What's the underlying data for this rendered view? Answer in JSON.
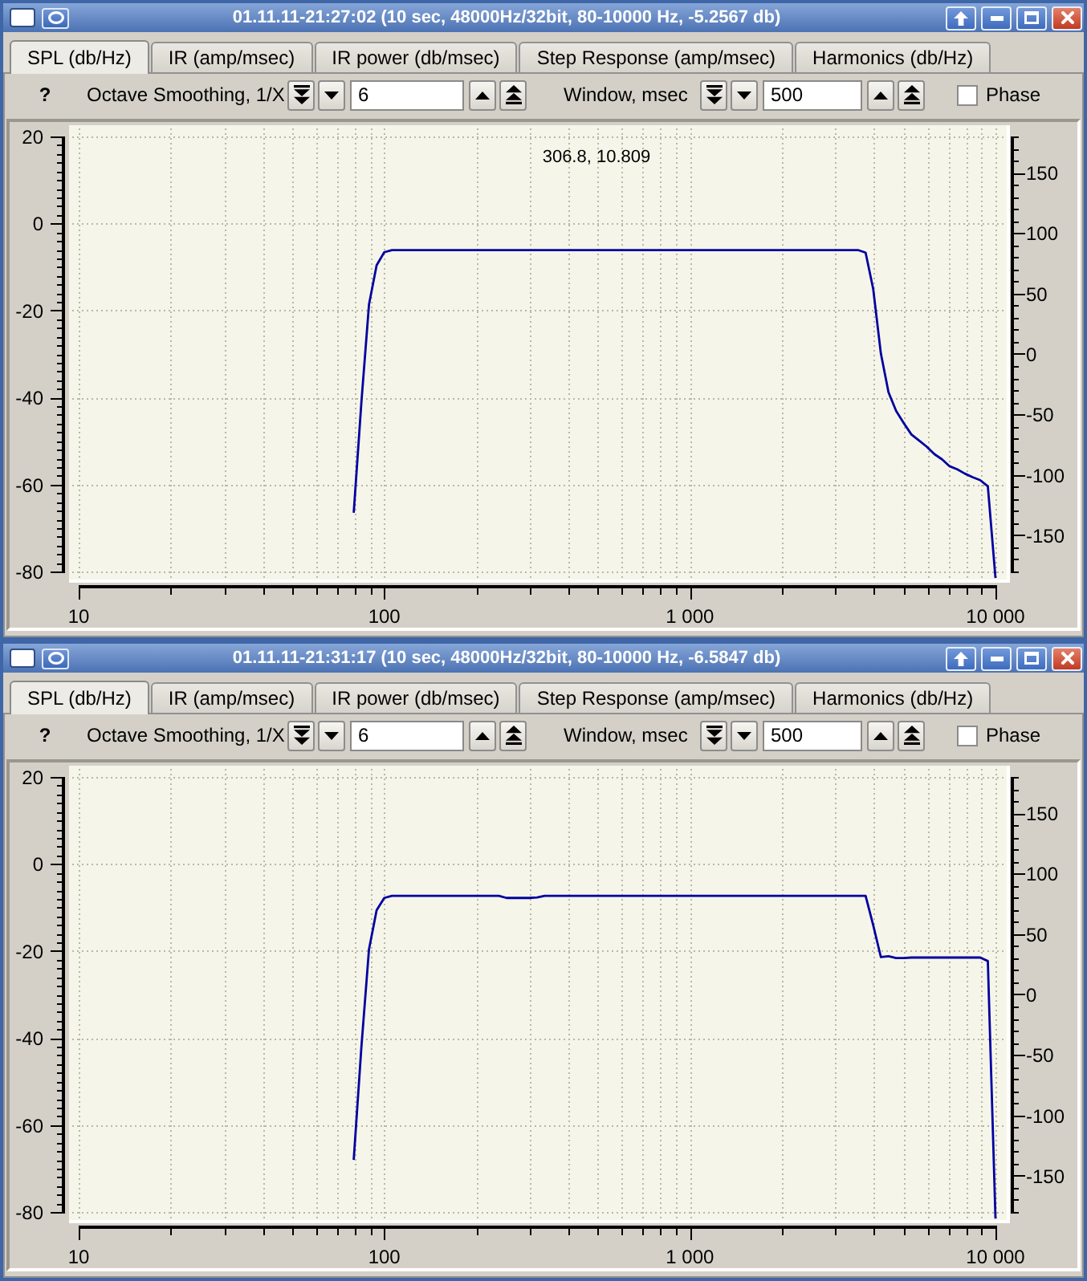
{
  "windows": [
    {
      "title": "01.11.11-21:27:02 (10 sec, 48000Hz/32bit, 80-10000 Hz, -5.2567 db)",
      "tabs": [
        {
          "label": "SPL (db/Hz)",
          "selected": true
        },
        {
          "label": "IR (amp/msec)",
          "selected": false
        },
        {
          "label": "IR power (db/msec)",
          "selected": false
        },
        {
          "label": "Step Response (amp/msec)",
          "selected": false
        },
        {
          "label": "Harmonics (db/Hz)",
          "selected": false
        }
      ],
      "toolbar": {
        "help": "?",
        "smoothing": {
          "label": "Octave Smoothing, 1/X",
          "value": "6"
        },
        "window": {
          "label": "Window, msec",
          "value": "500"
        },
        "phase": {
          "label": "Phase",
          "checked": false
        }
      },
      "chart_data": {
        "type": "line",
        "grid": true,
        "ylim": [
          -82.2,
          22.6
        ],
        "yticks": [
          20,
          0,
          -20,
          -40,
          -60,
          -80
        ],
        "y2lim": [
          -188,
          189.3
        ],
        "y2ticks": [
          150,
          100,
          50,
          0,
          -50,
          -100,
          -150
        ],
        "categories": [
          "10",
          null,
          null,
          null,
          null,
          null,
          null,
          null,
          null,
          null,
          null,
          null,
          null,
          null,
          null,
          null,
          null,
          null,
          null,
          null,
          null,
          null,
          null,
          null,
          null,
          null,
          null,
          null,
          null,
          null,
          null,
          null,
          null,
          null,
          null,
          null,
          null,
          null,
          null,
          null,
          "100",
          null,
          null,
          null,
          null,
          null,
          null,
          null,
          null,
          null,
          null,
          null,
          null,
          null,
          null,
          null,
          null,
          null,
          null,
          null,
          null,
          null,
          null,
          null,
          null,
          null,
          null,
          null,
          null,
          null,
          null,
          null,
          null,
          null,
          null,
          null,
          null,
          null,
          null,
          null,
          "1 000",
          null,
          null,
          null,
          null,
          null,
          null,
          null,
          null,
          null,
          null,
          null,
          null,
          null,
          null,
          null,
          null,
          null,
          null,
          null,
          null,
          null,
          null,
          null,
          null,
          null,
          null,
          null,
          null,
          null,
          null,
          null,
          null,
          null,
          null,
          null,
          null,
          null,
          null,
          null,
          "10 000"
        ],
        "series": [
          {
            "color": "#0000a0",
            "values": [
              null,
              null,
              null,
              null,
              null,
              null,
              null,
              null,
              null,
              null,
              null,
              null,
              null,
              null,
              null,
              null,
              null,
              null,
              null,
              null,
              null,
              null,
              null,
              null,
              null,
              null,
              null,
              null,
              null,
              null,
              null,
              null,
              null,
              null,
              null,
              null,
              -66.5,
              -41.2,
              -18.6,
              -9.6,
              -6.6,
              -6.1,
              -6.1,
              -6.1,
              -6.1,
              -6.1,
              -6.1,
              -6.1,
              -6.1,
              -6.1,
              -6.1,
              -6.1,
              -6.1,
              -6.1,
              -6.1,
              -6.1,
              -6.1,
              -6.1,
              -6.1,
              -6.1,
              -6.1,
              -6.1,
              -6.1,
              -6.1,
              -6.1,
              -6.1,
              -6.1,
              -6.1,
              -6.1,
              -6.1,
              -6.1,
              -6.1,
              -6.1,
              -6.1,
              -6.1,
              -6.1,
              -6.1,
              -6.1,
              -6.1,
              -6.1,
              -6.1,
              -6.1,
              -6.1,
              -6.1,
              -6.1,
              -6.1,
              -6.1,
              -6.1,
              -6.1,
              -6.1,
              -6.1,
              -6.1,
              -6.1,
              -6.1,
              -6.1,
              -6.1,
              -6.1,
              -6.1,
              -6.1,
              -6.1,
              -6.1,
              -6.1,
              -6.1,
              -6.7,
              -15.1,
              -29.9,
              -38.8,
              -43.1,
              -45.9,
              -48.5,
              -49.9,
              -51.3,
              -53,
              -54.2,
              -55.8,
              -56.5,
              -57.5,
              -58.3,
              -59,
              -60.4,
              -81.5
            ]
          }
        ],
        "annotations": [
          "306.8, 10.809"
        ]
      }
    },
    {
      "title": "01.11.11-21:31:17 (10 sec, 48000Hz/32bit, 80-10000 Hz, -6.5847 db)",
      "tabs": [
        {
          "label": "SPL (db/Hz)",
          "selected": true
        },
        {
          "label": "IR (amp/msec)",
          "selected": false
        },
        {
          "label": "IR power (db/msec)",
          "selected": false
        },
        {
          "label": "Step Response (amp/msec)",
          "selected": false
        },
        {
          "label": "Harmonics (db/Hz)",
          "selected": false
        }
      ],
      "toolbar": {
        "help": "?",
        "smoothing": {
          "label": "Octave Smoothing, 1/X",
          "value": "6"
        },
        "window": {
          "label": "Window, msec",
          "value": "500"
        },
        "phase": {
          "label": "Phase",
          "checked": false
        }
      },
      "chart_data": {
        "type": "line",
        "grid": true,
        "ylim": [
          -82.2,
          22.6
        ],
        "yticks": [
          20,
          0,
          -20,
          -40,
          -60,
          -80
        ],
        "y2lim": [
          -188,
          189.3
        ],
        "y2ticks": [
          150,
          100,
          50,
          0,
          -50,
          -100,
          -150
        ],
        "categories": [
          "10",
          null,
          null,
          null,
          null,
          null,
          null,
          null,
          null,
          null,
          null,
          null,
          null,
          null,
          null,
          null,
          null,
          null,
          null,
          null,
          null,
          null,
          null,
          null,
          null,
          null,
          null,
          null,
          null,
          null,
          null,
          null,
          null,
          null,
          null,
          null,
          null,
          null,
          null,
          null,
          "100",
          null,
          null,
          null,
          null,
          null,
          null,
          null,
          null,
          null,
          null,
          null,
          null,
          null,
          null,
          null,
          null,
          null,
          null,
          null,
          null,
          null,
          null,
          null,
          null,
          null,
          null,
          null,
          null,
          null,
          null,
          null,
          null,
          null,
          null,
          null,
          null,
          null,
          null,
          null,
          "1 000",
          null,
          null,
          null,
          null,
          null,
          null,
          null,
          null,
          null,
          null,
          null,
          null,
          null,
          null,
          null,
          null,
          null,
          null,
          null,
          null,
          null,
          null,
          null,
          null,
          null,
          null,
          null,
          null,
          null,
          null,
          null,
          null,
          null,
          null,
          null,
          null,
          null,
          null,
          null,
          "10 000"
        ],
        "series": [
          {
            "color": "#0000a0",
            "values": [
              null,
              null,
              null,
              null,
              null,
              null,
              null,
              null,
              null,
              null,
              null,
              null,
              null,
              null,
              null,
              null,
              null,
              null,
              null,
              null,
              null,
              null,
              null,
              null,
              null,
              null,
              null,
              null,
              null,
              null,
              null,
              null,
              null,
              null,
              null,
              null,
              -68,
              -42.2,
              -19.6,
              -10.6,
              -7.8,
              -7.3,
              -7.3,
              -7.3,
              -7.3,
              -7.3,
              -7.3,
              -7.3,
              -7.3,
              -7.3,
              -7.3,
              -7.3,
              -7.3,
              -7.3,
              -7.3,
              -7.3,
              -7.8,
              -7.8,
              -7.8,
              -7.8,
              -7.7,
              -7.3,
              -7.3,
              -7.3,
              -7.3,
              -7.3,
              -7.3,
              -7.3,
              -7.3,
              -7.3,
              -7.3,
              -7.3,
              -7.3,
              -7.3,
              -7.3,
              -7.3,
              -7.3,
              -7.3,
              -7.3,
              -7.3,
              -7.3,
              -7.3,
              -7.3,
              -7.3,
              -7.3,
              -7.3,
              -7.3,
              -7.3,
              -7.3,
              -7.3,
              -7.3,
              -7.3,
              -7.3,
              -7.3,
              -7.3,
              -7.3,
              -7.3,
              -7.3,
              -7.3,
              -7.3,
              -7.3,
              -7.3,
              -7.3,
              -7.3,
              -14.1,
              -21.4,
              -21.2,
              -21.6,
              -21.6,
              -21.5,
              -21.5,
              -21.5,
              -21.5,
              -21.5,
              -21.5,
              -21.5,
              -21.5,
              -21.5,
              -21.5,
              -22.3,
              -81.5
            ]
          }
        ]
      }
    }
  ]
}
